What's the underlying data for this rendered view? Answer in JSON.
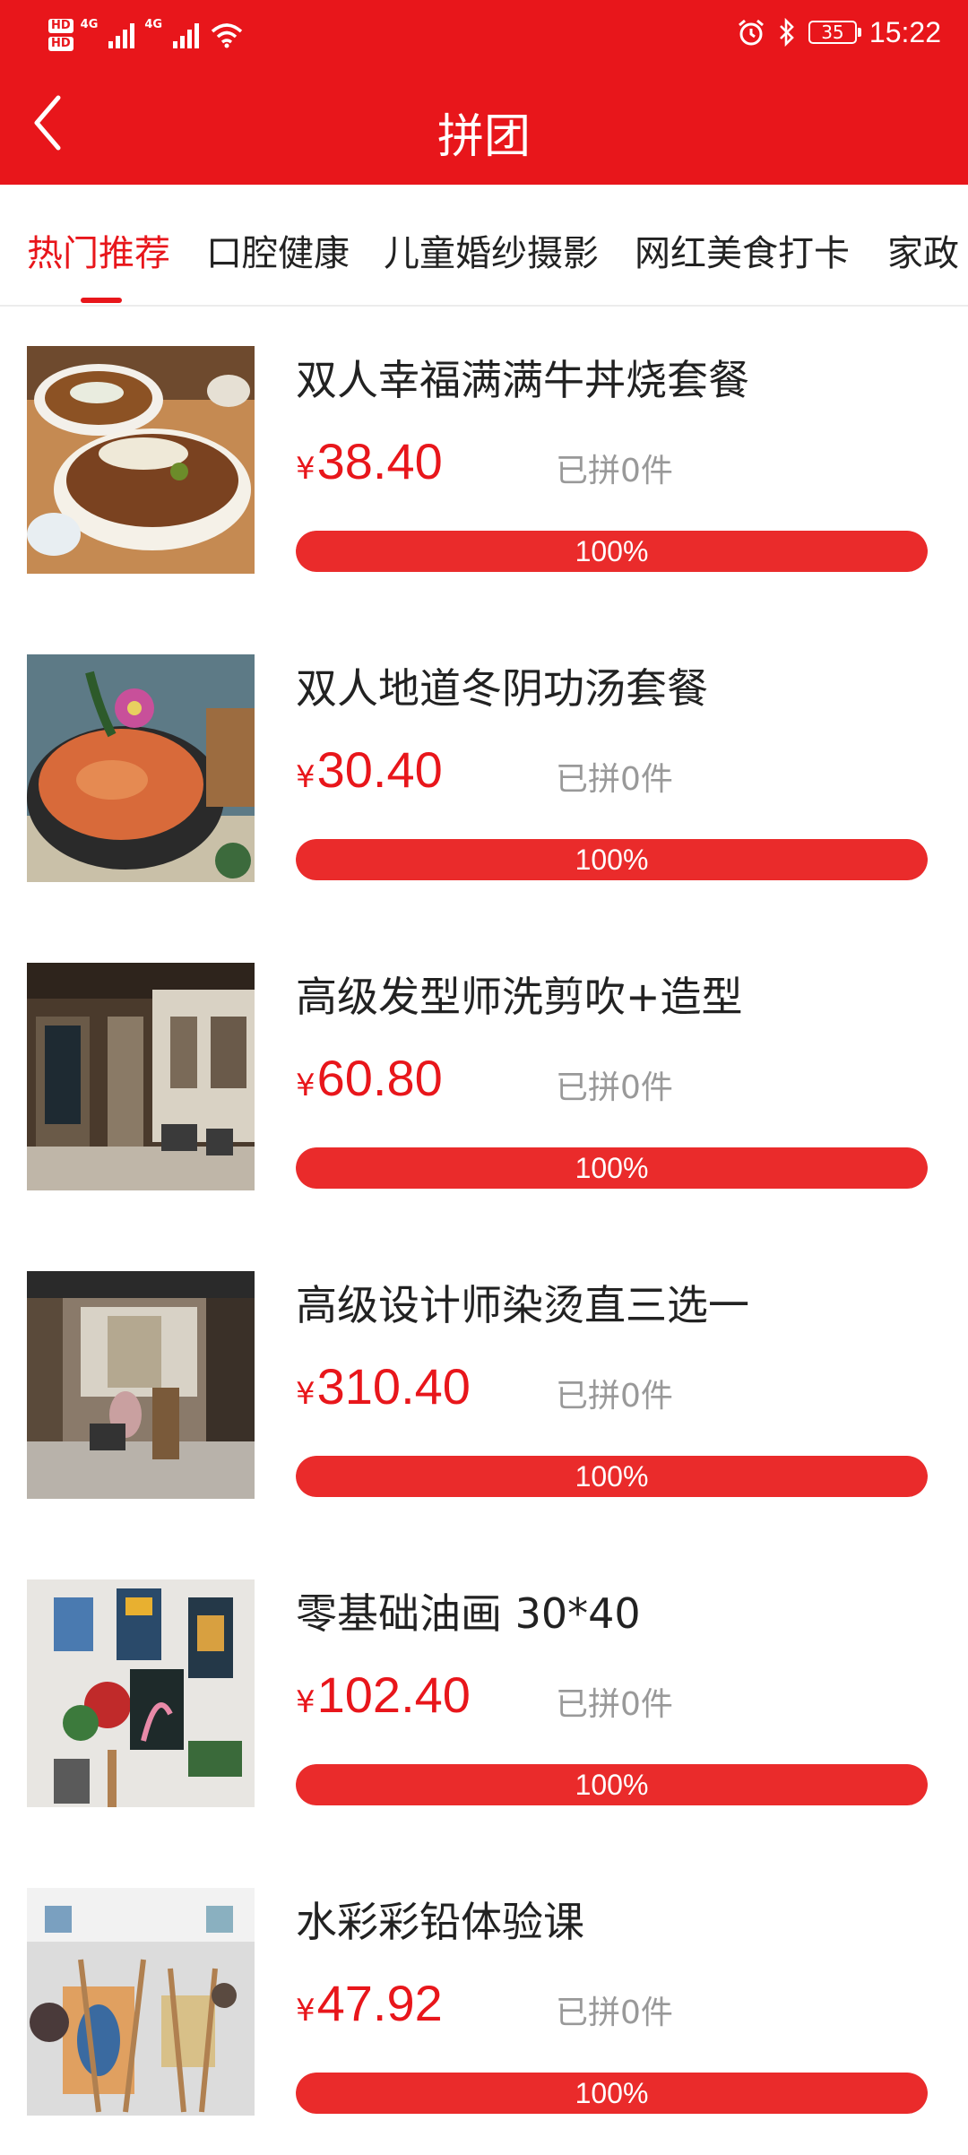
{
  "status_bar": {
    "network_left": "HD",
    "network_left2": "HD",
    "signal1_label": "4G",
    "signal2_label": "4G",
    "battery": "35",
    "time": "15:22"
  },
  "nav": {
    "title": "拼团",
    "back_icon": "chevron-left-icon"
  },
  "tabs": [
    {
      "label": "热门推荐",
      "active": true
    },
    {
      "label": "口腔健康",
      "active": false
    },
    {
      "label": "儿童婚纱摄影",
      "active": false
    },
    {
      "label": "网红美食打卡",
      "active": false
    },
    {
      "label": "家政",
      "active": false
    }
  ],
  "items": [
    {
      "title": "双人幸福满满牛丼烧套餐",
      "currency": "¥",
      "price": "38.40",
      "sold": "已拼0件",
      "progress": 1.0,
      "progress_label": "100%",
      "image": "beef-bowl"
    },
    {
      "title": "双人地道冬阴功汤套餐",
      "currency": "¥",
      "price": "30.40",
      "sold": "已拼0件",
      "progress": 1.0,
      "progress_label": "100%",
      "image": "tom-yum-soup"
    },
    {
      "title": "高级发型师洗剪吹+造型",
      "currency": "¥",
      "price": "60.80",
      "sold": "已拼0件",
      "progress": 1.0,
      "progress_label": "100%",
      "image": "hair-salon"
    },
    {
      "title": "高级设计师染烫直三选一",
      "currency": "¥",
      "price": "310.40",
      "sold": "已拼0件",
      "progress": 1.0,
      "progress_label": "100%",
      "image": "salon-interior"
    },
    {
      "title": "零基础油画 30*40",
      "currency": "¥",
      "price": "102.40",
      "sold": "已拼0件",
      "progress": 1.0,
      "progress_label": "100%",
      "image": "oil-painting"
    },
    {
      "title": "水彩彩铅体验课",
      "currency": "¥",
      "price": "47.92",
      "sold": "已拼0件",
      "progress": 1.0,
      "progress_label": "100%",
      "image": "watercolor-class"
    }
  ],
  "colors": {
    "brand": "#e8161b",
    "progress": "#ea2b2b",
    "muted": "#999999"
  }
}
